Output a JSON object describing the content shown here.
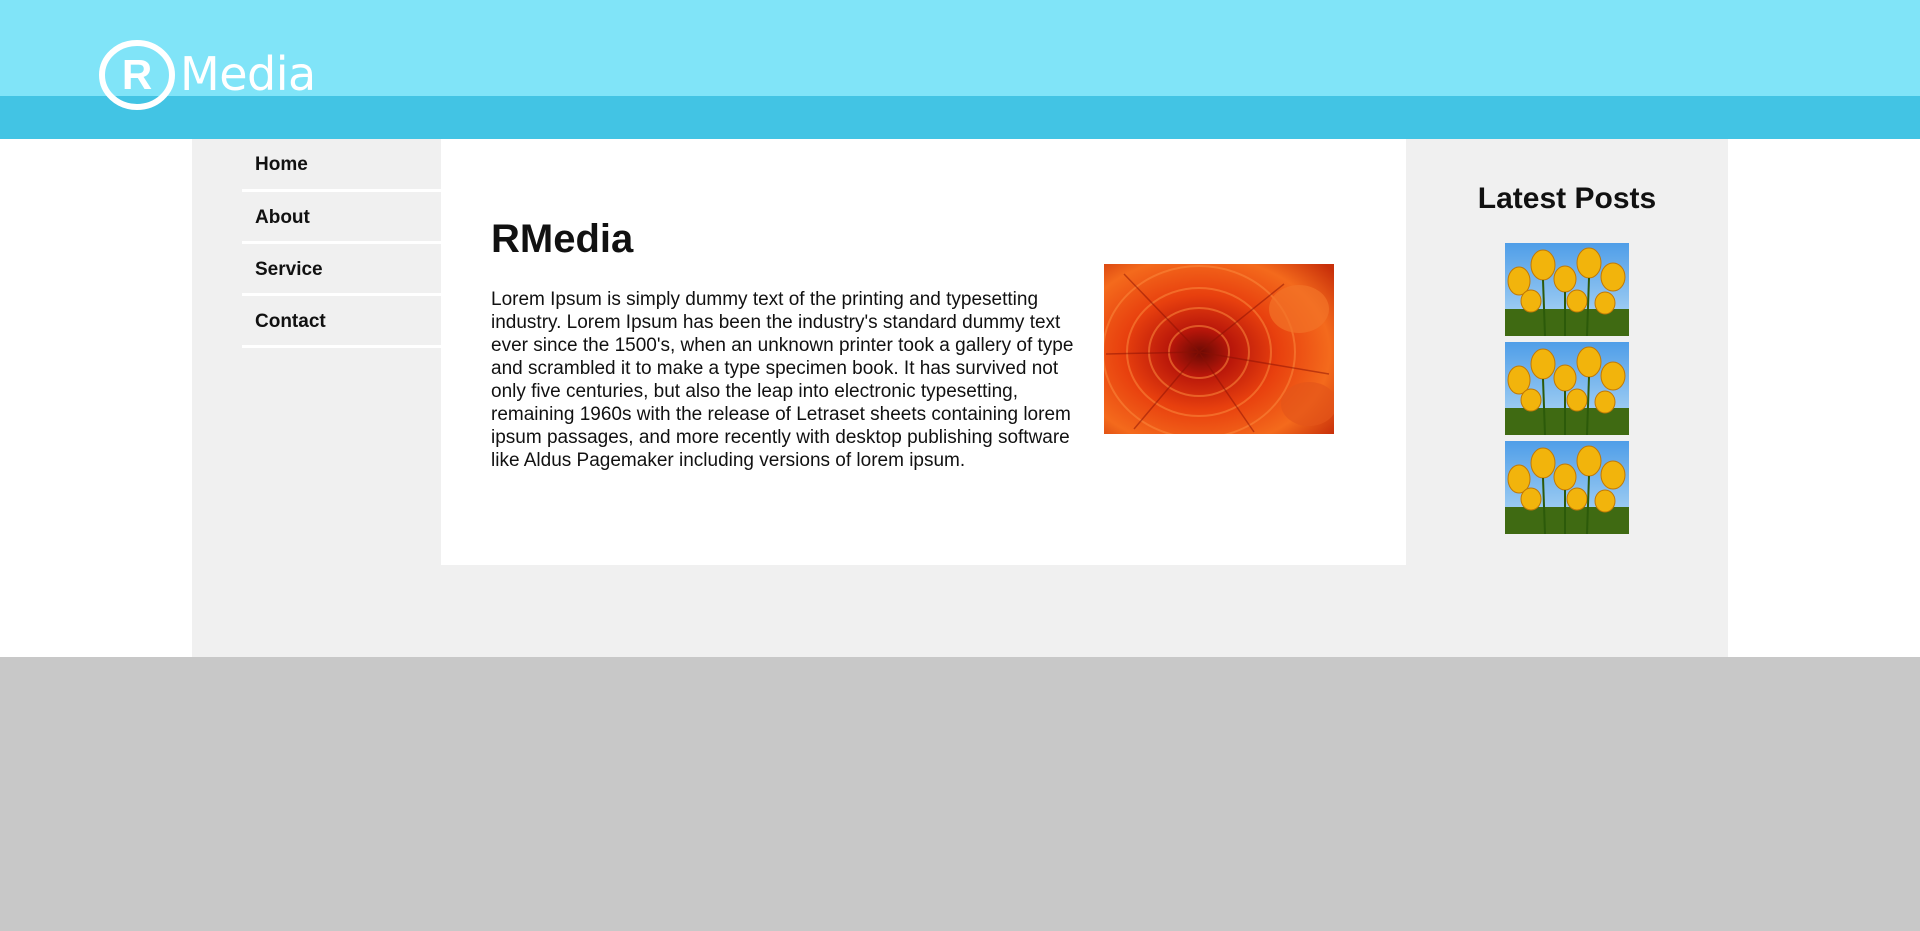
{
  "header": {
    "logo_letter": "R",
    "logo_text": "Media",
    "colors": {
      "top": "#80e4f8",
      "band": "#42c4e4"
    }
  },
  "nav": {
    "items": [
      {
        "label": "Home"
      },
      {
        "label": "About"
      },
      {
        "label": "Service"
      },
      {
        "label": "Contact"
      }
    ]
  },
  "main": {
    "title": "RMedia",
    "body": "Lorem Ipsum is simply dummy text of the printing and typesetting industry. Lorem Ipsum has been the industry's standard dummy text ever since the 1500's, when an unknown printer took a gallery of type and scrambled it to make a type specimen book. It has survived not only five centuries, but also the leap into electronic typesetting, remaining 1960s with the release of Letraset sheets containing lorem ipsum passages, and more recently with desktop publishing software like Aldus Pagemaker including versions of lorem ipsum.",
    "image": "chrysanthemum-photo"
  },
  "sidebar": {
    "title": "Latest Posts",
    "posts": [
      {
        "image": "tulips-photo"
      },
      {
        "image": "tulips-photo"
      },
      {
        "image": "tulips-photo"
      }
    ]
  },
  "colors": {
    "container_bg": "#f0f0f0",
    "footer_bg": "#c8c8c8",
    "text": "#111111"
  }
}
